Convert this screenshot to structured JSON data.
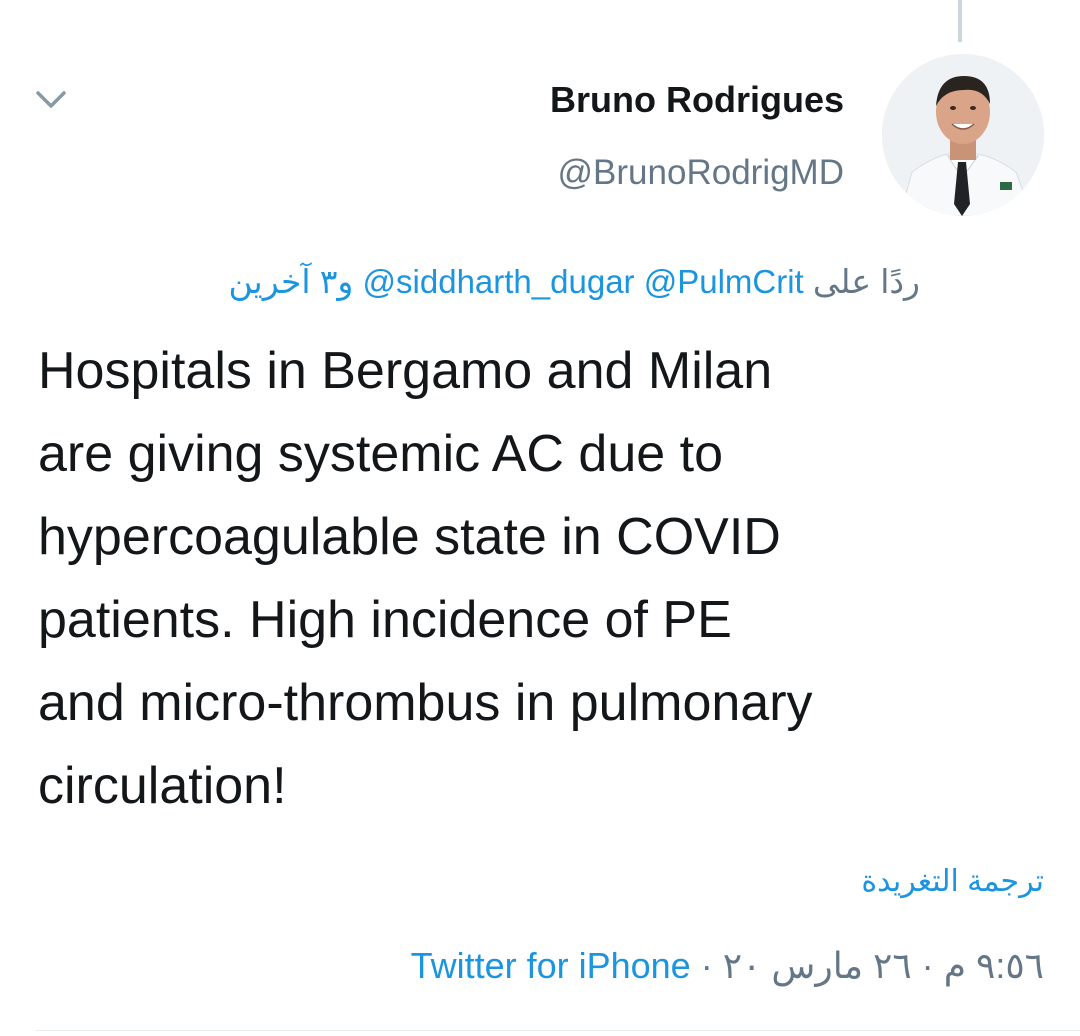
{
  "tweet": {
    "author_name": "Bruno Rodrigues",
    "author_handle": "@BrunoRodrigMD",
    "reply_prefix": "ردًا على",
    "reply_mentions": [
      "@PulmCrit",
      "@siddharth_dugar"
    ],
    "reply_others": "و٣ آخرين",
    "text_lines": [
      "Hospitals in Bergamo and Milan",
      "are giving systemic AC due to",
      "hypercoagulable state in COVID",
      "patients. High incidence of PE",
      "and micro-thrombus in pulmonary",
      "circulation!"
    ],
    "translate_label": "ترجمة التغريدة",
    "time": "٩:٥٦ م",
    "date": "٢٦ مارس ٢٠",
    "separator": "·",
    "source": "Twitter for iPhone"
  },
  "icons": {
    "menu": "chevron-down-icon",
    "avatar": "avatar-photo"
  },
  "colors": {
    "link": "#1b95e0",
    "secondary_text": "#657786",
    "primary_text": "#14171a",
    "thread_line": "#ccd6dd"
  }
}
